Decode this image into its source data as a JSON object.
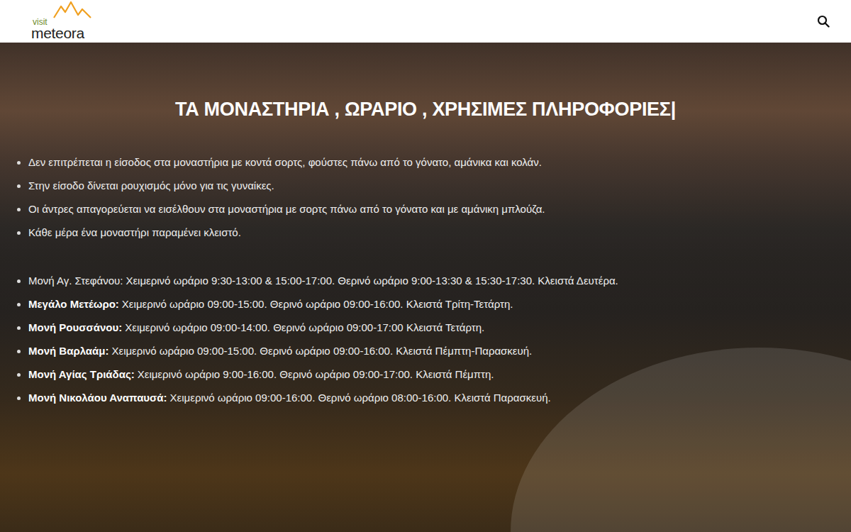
{
  "header": {
    "logo": {
      "small": "visit",
      "large": "meteora"
    }
  },
  "hero": {
    "title": "ΤΑ ΜΟΝΑΣΤΗΡΙΑ , ΩΡΑΡΙΟ , ΧΡΗΣΙΜΕΣ ΠΛΗΡΟΦΟΡΙΕΣ|",
    "rules": [
      "Δεν επιτρέπεται η είσοδος στα μοναστήρια με κοντά σορτς, φούστες πάνω από το γόνατο, αμάνικα και κολάν.",
      "Στην είσοδο δίνεται ρουχισμός μόνο για τις γυναίκες.",
      "Οι άντρες απαγορεύεται να εισέλθουν στα μοναστήρια με σορτς πάνω από το γόνατο και με αμάνικη μπλούζα.",
      "Κάθε μέρα ένα μοναστήρι παραμένει κλειστό."
    ],
    "monasteries": [
      {
        "name": "Μονή Αγ. Στεφάνου:",
        "details": "Χειμερινό ωράριο 9:30-13:00 & 15:00-17:00. Θερινό ωράριο 9:00-13:30 & 15:30-17:30. Κλειστά Δευτέρα.",
        "bold": false
      },
      {
        "name": "Μεγάλο Μετέωρο:",
        "details": "Χειμερινό ωράριο 09:00-15:00. Θερινό ωράριο 09:00-16:00. Κλειστά Τρίτη-Τετάρτη.",
        "bold": true
      },
      {
        "name": "Μονή Ρουσσάνου:",
        "details": "Χειμερινό ωράριο 09:00-14:00. Θερινό ωράριο 09:00-17:00 Κλειστά Τετάρτη.",
        "bold": true
      },
      {
        "name": "Μονή Βαρλαάμ:",
        "details": "Χειμερινό ωράριο 09:00-15:00. Θερινό ωράριο 09:00-16:00. Κλειστά Πέμπτη-Παρασκευή.",
        "bold": true
      },
      {
        "name": "Μονή Αγίας Τριάδας:",
        "details": "Χειμερινό ωράριο 9:00-16:00. Θερινό ωράριο 09:00-17:00. Κλειστά Πέμπτη.",
        "bold": true
      },
      {
        "name": "Μονή Νικολάου Αναπαυσά:",
        "details": "Χειμερινό ωράριο 09:00-16:00. Θερινό ωράριο 08:00-16:00. Κλειστά Παρασκευή.",
        "bold": true
      }
    ]
  }
}
